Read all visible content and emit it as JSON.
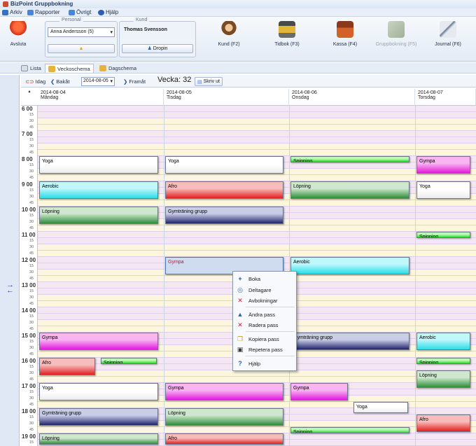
{
  "window": {
    "title": "BizPoint Gruppbokning"
  },
  "menu": [
    {
      "label": "Arkiv",
      "icon": "folder-icon",
      "color": "#3a6fc2"
    },
    {
      "label": "Rapporter",
      "icon": "report-icon",
      "color": "#4a86d8"
    },
    {
      "label": "Övrigt",
      "icon": "tools-icon",
      "color": "#4a86d8"
    },
    {
      "label": "Hjälp",
      "icon": "help-icon",
      "color": "#2f5fb3"
    }
  ],
  "toolbar": {
    "avsluta": "Avsluta",
    "personal": {
      "legend": "Personal",
      "value": "Anna Andersson (5)"
    },
    "kund": {
      "legend": "Kund",
      "value": "Thomas Svensson",
      "dropin": "Dropin"
    },
    "buttons": [
      {
        "label": "Kund (F2)",
        "icon": "customer-icon",
        "enabled": true
      },
      {
        "label": "Tidbok (F3)",
        "icon": "calendar-book-icon",
        "enabled": true
      },
      {
        "label": "Kassa (F4)",
        "icon": "cash-register-icon",
        "enabled": true
      },
      {
        "label": "Gruppbokning (F5)",
        "icon": "group-booking-icon",
        "enabled": false
      },
      {
        "label": "Journal (F6)",
        "icon": "journal-icon",
        "enabled": true
      }
    ]
  },
  "view_tabs": [
    {
      "label": "Lista",
      "active": false
    },
    {
      "label": "Veckoschema",
      "active": true
    },
    {
      "label": "Dagschema",
      "active": false
    }
  ],
  "nav": {
    "today": "Idag",
    "back": "Bakåt",
    "date": "2014-08-05",
    "forward": "Framåt",
    "week": "Vecka: 32",
    "print": "Skriv ut"
  },
  "days": [
    {
      "date": "2014-08-04",
      "name": "Måndag"
    },
    {
      "date": "2014-08-05",
      "name": "Tisdag"
    },
    {
      "date": "2014-08-06",
      "name": "Onsdag"
    },
    {
      "date": "2014-08-07",
      "name": "Torsdag"
    }
  ],
  "hours": [
    "6 00",
    "7 00",
    "8 00",
    "9 00",
    "10 00",
    "11 00",
    "12 00",
    "13 00",
    "14 00",
    "15 00",
    "16 00",
    "17 00",
    "18 00",
    "19 00"
  ],
  "quarter_labels": [
    "15",
    "30",
    "45"
  ],
  "events": [
    {
      "label": "Yoga",
      "day": 0,
      "start": "08:00",
      "end": "08:45",
      "color": "white"
    },
    {
      "label": "Aerobic",
      "day": 0,
      "start": "09:00",
      "end": "09:45",
      "color": "cyan"
    },
    {
      "label": "Löpning",
      "day": 0,
      "start": "10:00",
      "end": "10:45",
      "color": "green"
    },
    {
      "label": "Gympa",
      "day": 0,
      "start": "15:00",
      "end": "15:45",
      "color": "magenta"
    },
    {
      "label": "Afro",
      "day": 0,
      "start": "16:00",
      "end": "16:45",
      "color": "red"
    },
    {
      "label": "Spinning",
      "day": 0,
      "start": "16:00",
      "end": "16:15",
      "color": "lime"
    },
    {
      "label": "Yoga",
      "day": 0,
      "start": "17:00",
      "end": "17:45",
      "color": "white"
    },
    {
      "label": "Gymträning grupp",
      "day": 0,
      "start": "18:00",
      "end": "18:45",
      "color": "navy"
    },
    {
      "label": "Löpning",
      "day": 0,
      "start": "19:00",
      "end": "19:30",
      "color": "green"
    },
    {
      "label": "Yoga",
      "day": 1,
      "start": "08:00",
      "end": "08:45",
      "color": "white"
    },
    {
      "label": "Afro",
      "day": 1,
      "start": "09:00",
      "end": "09:45",
      "color": "red"
    },
    {
      "label": "Gymträning grupp",
      "day": 1,
      "start": "10:00",
      "end": "10:45",
      "color": "navy"
    },
    {
      "label": "Gympa",
      "day": 1,
      "start": "12:00",
      "end": "12:45",
      "color": "selected"
    },
    {
      "label": "Gympa",
      "day": 1,
      "start": "17:00",
      "end": "17:45",
      "color": "magenta"
    },
    {
      "label": "Löpning",
      "day": 1,
      "start": "18:00",
      "end": "18:45",
      "color": "green"
    },
    {
      "label": "Afro",
      "day": 1,
      "start": "19:00",
      "end": "19:30",
      "color": "red"
    },
    {
      "label": "Spinning",
      "day": 2,
      "start": "08:00",
      "end": "08:15",
      "color": "lime"
    },
    {
      "label": "Löpning",
      "day": 2,
      "start": "09:00",
      "end": "09:45",
      "color": "green"
    },
    {
      "label": "Aerobic",
      "day": 2,
      "start": "12:00",
      "end": "12:45",
      "color": "cyan"
    },
    {
      "label": "Gymträning grupp",
      "day": 2,
      "start": "15:00",
      "end": "15:45",
      "color": "navy"
    },
    {
      "label": "Gympa",
      "day": 2,
      "start": "17:00",
      "end": "17:45",
      "color": "magenta"
    },
    {
      "label": "Yoga",
      "day": 2,
      "start": "17:45",
      "end": "18:15",
      "color": "white"
    },
    {
      "label": "Spinning",
      "day": 2,
      "start": "18:45",
      "end": "19:00",
      "color": "lime"
    },
    {
      "label": "Gympa",
      "day": 3,
      "start": "08:00",
      "end": "08:45",
      "color": "magenta"
    },
    {
      "label": "Yoga",
      "day": 3,
      "start": "09:00",
      "end": "09:45",
      "color": "white"
    },
    {
      "label": "Spinning",
      "day": 3,
      "start": "11:00",
      "end": "11:15",
      "color": "lime"
    },
    {
      "label": "Aerobic",
      "day": 3,
      "start": "15:00",
      "end": "15:45",
      "color": "cyan"
    },
    {
      "label": "Spinning",
      "day": 3,
      "start": "16:00",
      "end": "16:15",
      "color": "lime"
    },
    {
      "label": "Löpning",
      "day": 3,
      "start": "16:30",
      "end": "17:15",
      "color": "green"
    },
    {
      "label": "Afro",
      "day": 3,
      "start": "18:15",
      "end": "19:00",
      "color": "red"
    }
  ],
  "context_menu": [
    {
      "label": "Boka",
      "icon": "plus-icon",
      "glyph": "+",
      "color": "#1f4f9c"
    },
    {
      "label": "Deltagare",
      "icon": "participants-icon",
      "glyph": "◎",
      "color": "#3b6bb8"
    },
    {
      "label": "Avbokningar",
      "icon": "cancel-icon",
      "glyph": "✕",
      "color": "#d0202a"
    },
    {
      "label": "Ändra pass",
      "icon": "edit-triangle-icon",
      "glyph": "▲",
      "color": "#2a64b8"
    },
    {
      "label": "Radera pass",
      "icon": "delete-icon",
      "glyph": "✕",
      "color": "#d0202a"
    },
    {
      "label": "Kopiera pass",
      "icon": "copy-icon",
      "glyph": "❐",
      "color": "#c4982a"
    },
    {
      "label": "Repetera pass",
      "icon": "repeat-icon",
      "glyph": "▣",
      "color": "#3a3a3a"
    },
    {
      "label": "Hjälp",
      "icon": "help-icon",
      "glyph": "?",
      "color": "#2f5fb3"
    }
  ],
  "colors": {
    "white": "#ffffff",
    "cyan": "#29dde9",
    "red": "#e41e1e",
    "green": "#2f8e3a",
    "navy": "#22246d",
    "magenta": "#e21adf",
    "lime": "#29d92b"
  }
}
